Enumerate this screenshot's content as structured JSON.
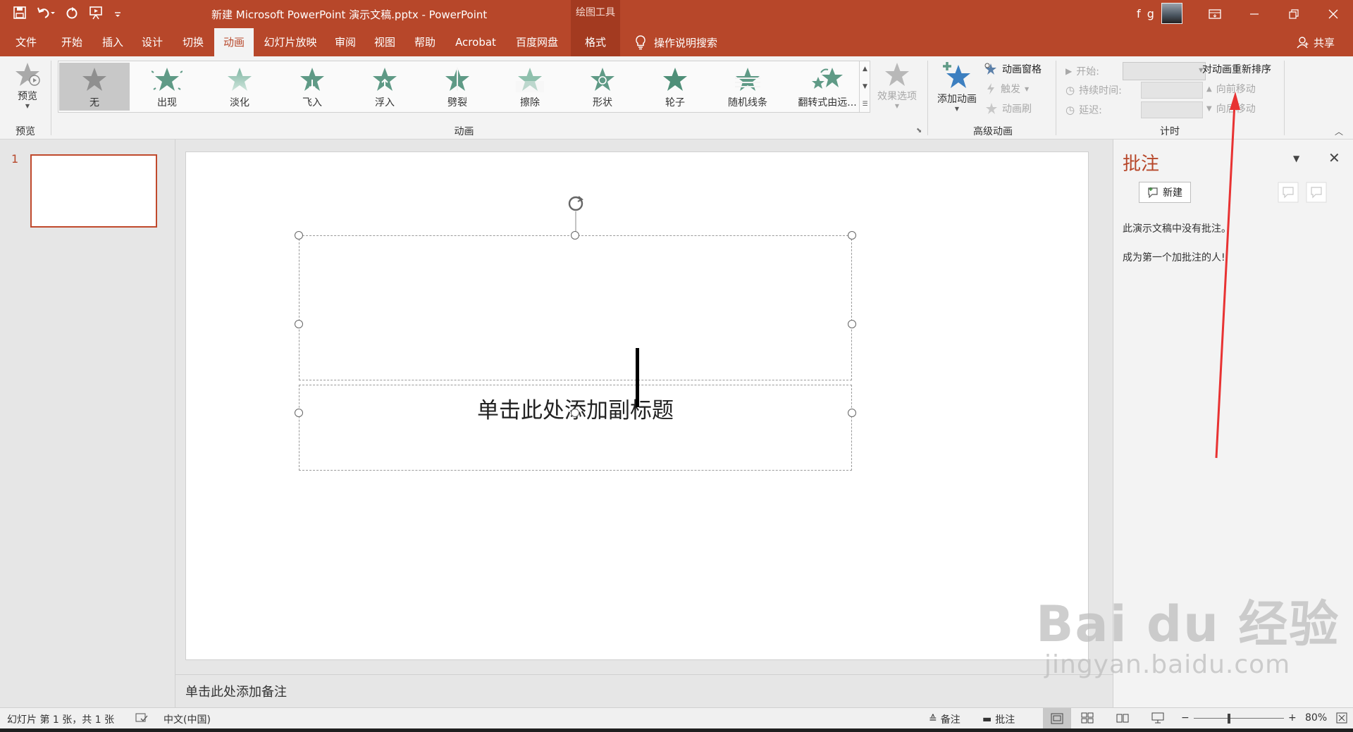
{
  "window": {
    "title": "新建 Microsoft PowerPoint 演示文稿.pptx - PowerPoint",
    "context_tab_header": "绘图工具",
    "user_name": "f g"
  },
  "tabs": [
    {
      "label": "文件"
    },
    {
      "label": "开始"
    },
    {
      "label": "插入"
    },
    {
      "label": "设计"
    },
    {
      "label": "切换"
    },
    {
      "label": "动画",
      "active": true
    },
    {
      "label": "幻灯片放映"
    },
    {
      "label": "审阅"
    },
    {
      "label": "视图"
    },
    {
      "label": "帮助"
    },
    {
      "label": "Acrobat"
    },
    {
      "label": "百度网盘"
    },
    {
      "label": "格式"
    }
  ],
  "tell_me": "操作说明搜索",
  "share": "共享",
  "ribbon": {
    "preview": {
      "label": "预览",
      "group_label": "预览"
    },
    "animation_group_label": "动画",
    "animations": [
      {
        "label": "无",
        "icon": "star-none-icon",
        "selected": true
      },
      {
        "label": "出现",
        "icon": "star-burst-icon"
      },
      {
        "label": "淡化",
        "icon": "star-fade-icon"
      },
      {
        "label": "飞入",
        "icon": "star-fly-in-icon"
      },
      {
        "label": "浮入",
        "icon": "star-float-in-icon"
      },
      {
        "label": "劈裂",
        "icon": "star-split-icon"
      },
      {
        "label": "擦除",
        "icon": "star-wipe-icon"
      },
      {
        "label": "形状",
        "icon": "star-shape-icon"
      },
      {
        "label": "轮子",
        "icon": "star-wheel-icon"
      },
      {
        "label": "随机线条",
        "icon": "star-random-bars-icon"
      },
      {
        "label": "翻转式由远...",
        "icon": "star-grow-turn-icon"
      }
    ],
    "effect_options": "效果选项",
    "advanced": {
      "group_label": "高级动画",
      "add_animation": "添加动画",
      "animation_pane": "动画窗格",
      "trigger": "触发",
      "animation_painter": "动画刷"
    },
    "timing": {
      "group_label": "计时",
      "start": "开始:",
      "duration": "持续时间:",
      "delay": "延迟:",
      "reorder": "对动画重新排序",
      "move_earlier": "向前移动",
      "move_later": "向后移动"
    }
  },
  "thumbnails": [
    {
      "number": "1"
    }
  ],
  "slide": {
    "subtitle_placeholder": "单击此处添加副标题"
  },
  "notes_placeholder": "单击此处添加备注",
  "comments_pane": {
    "title": "批注",
    "new_button": "新建",
    "empty_line1": "此演示文稿中没有批注。",
    "empty_line2": "成为第一个加批注的人!"
  },
  "watermark": {
    "main": "Bai du 经验",
    "sub": "jingyan.baidu.com"
  },
  "statusbar": {
    "slide_info": "幻灯片 第 1 张，共 1 张",
    "language": "中文(中国)",
    "notes": "备注",
    "comments": "批注",
    "zoom": "80%",
    "zoom_level_percent": 80
  },
  "colors": {
    "accent": "#b7472a",
    "context_tab": "#a33a20",
    "star_green": "#5f9a86",
    "star_blue": "#3c7fc0",
    "arrow_red": "#e83232"
  }
}
